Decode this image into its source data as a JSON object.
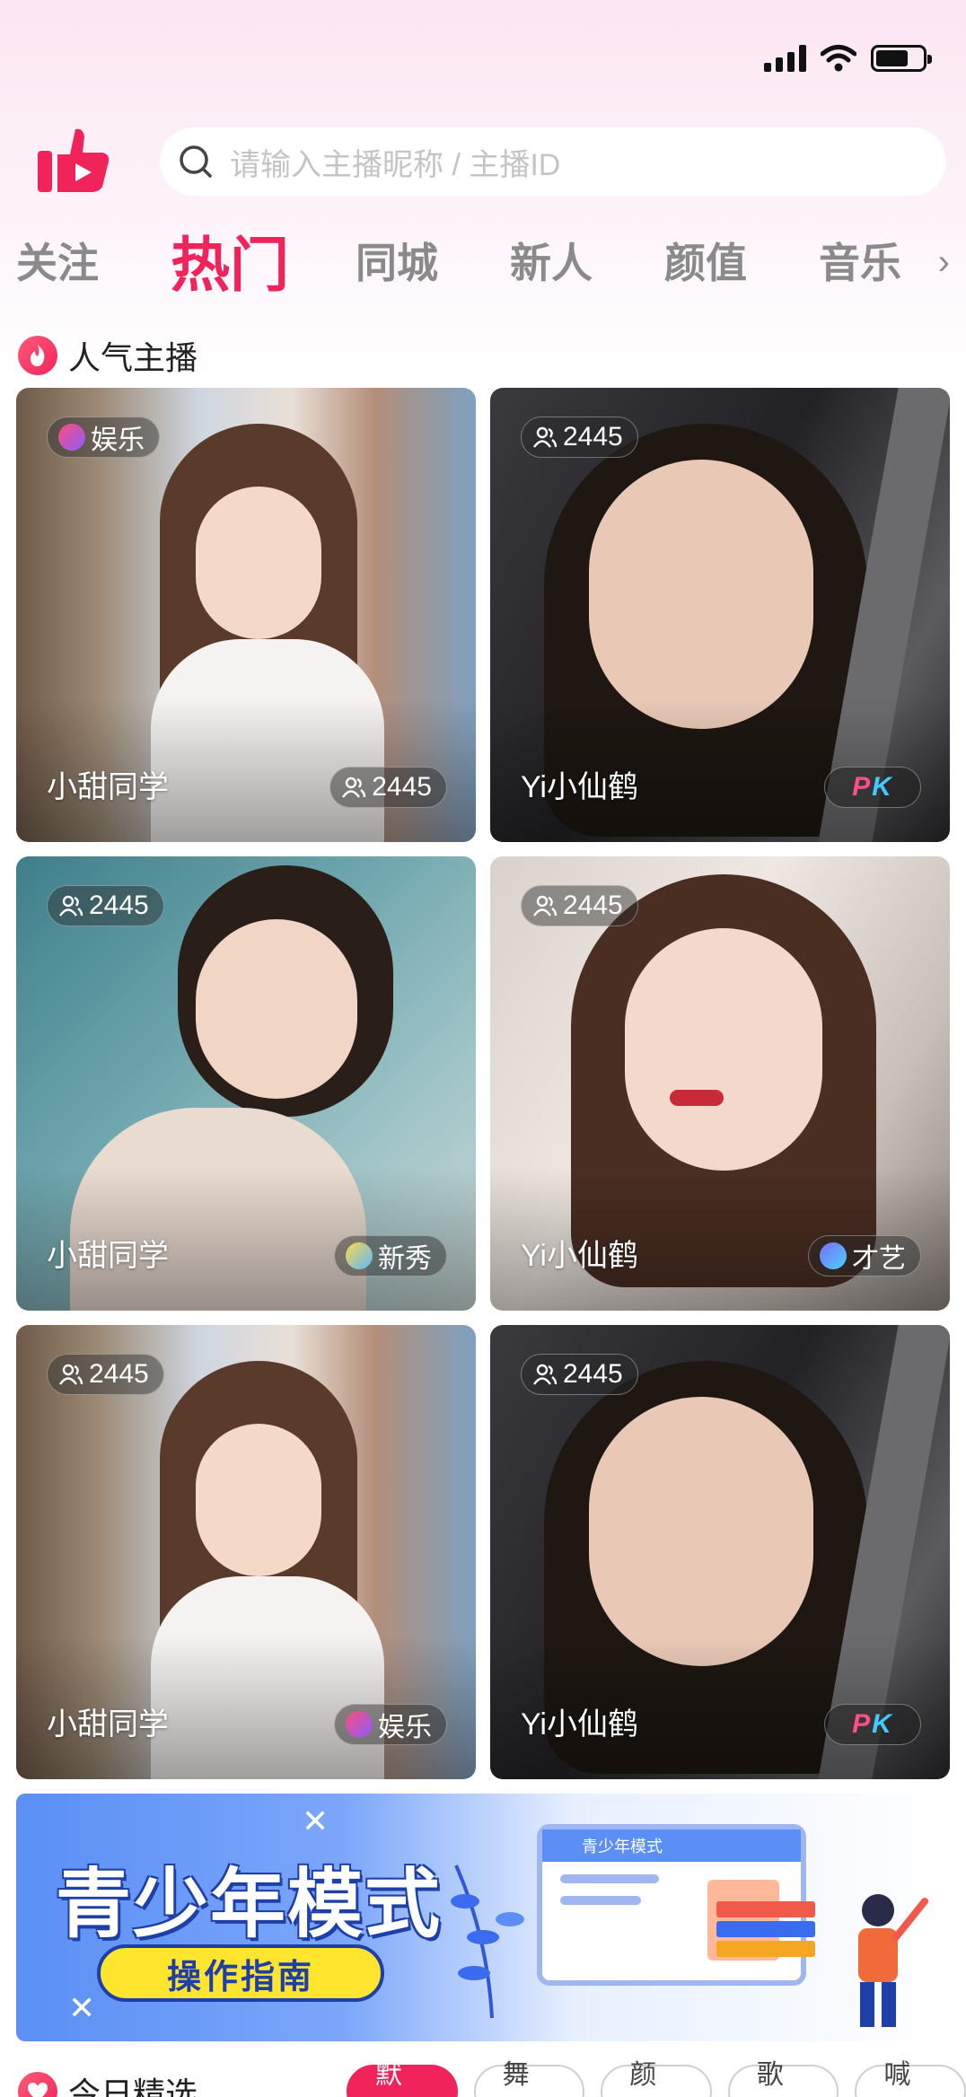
{
  "header": {
    "search_placeholder": "请输入主播昵称 / 主播ID"
  },
  "tabs": [
    {
      "label": "关注"
    },
    {
      "label": "热门",
      "active": true
    },
    {
      "label": "同城"
    },
    {
      "label": "新人"
    },
    {
      "label": "颜值"
    },
    {
      "label": "音乐"
    }
  ],
  "popular": {
    "title": "人气主播",
    "cards": [
      {
        "name": "小甜同学",
        "viewers": "2445",
        "tag": "娱乐"
      },
      {
        "name": "Yi小仙鹤",
        "viewers": "2445",
        "badge": "PK"
      },
      {
        "name": "小甜同学",
        "viewers": "2445",
        "tag": "新秀"
      },
      {
        "name": "Yi小仙鹤",
        "viewers": "2445",
        "tag": "才艺"
      },
      {
        "name": "小甜同学",
        "viewers": "2445",
        "tag": "娱乐"
      },
      {
        "name": "Yi小仙鹤",
        "viewers": "2445",
        "badge": "PK"
      }
    ]
  },
  "banner": {
    "title": "青少年模式",
    "button": "操作指南",
    "screen_label": "青少年模式"
  },
  "today": {
    "title": "今日精选",
    "filters": [
      "默认",
      "舞蹈",
      "颜值",
      "歌曲",
      "喊麦"
    ]
  },
  "colors": {
    "accent": "#f0245a",
    "pk_p": "#ff4e8a",
    "pk_k": "#43c9ff"
  }
}
